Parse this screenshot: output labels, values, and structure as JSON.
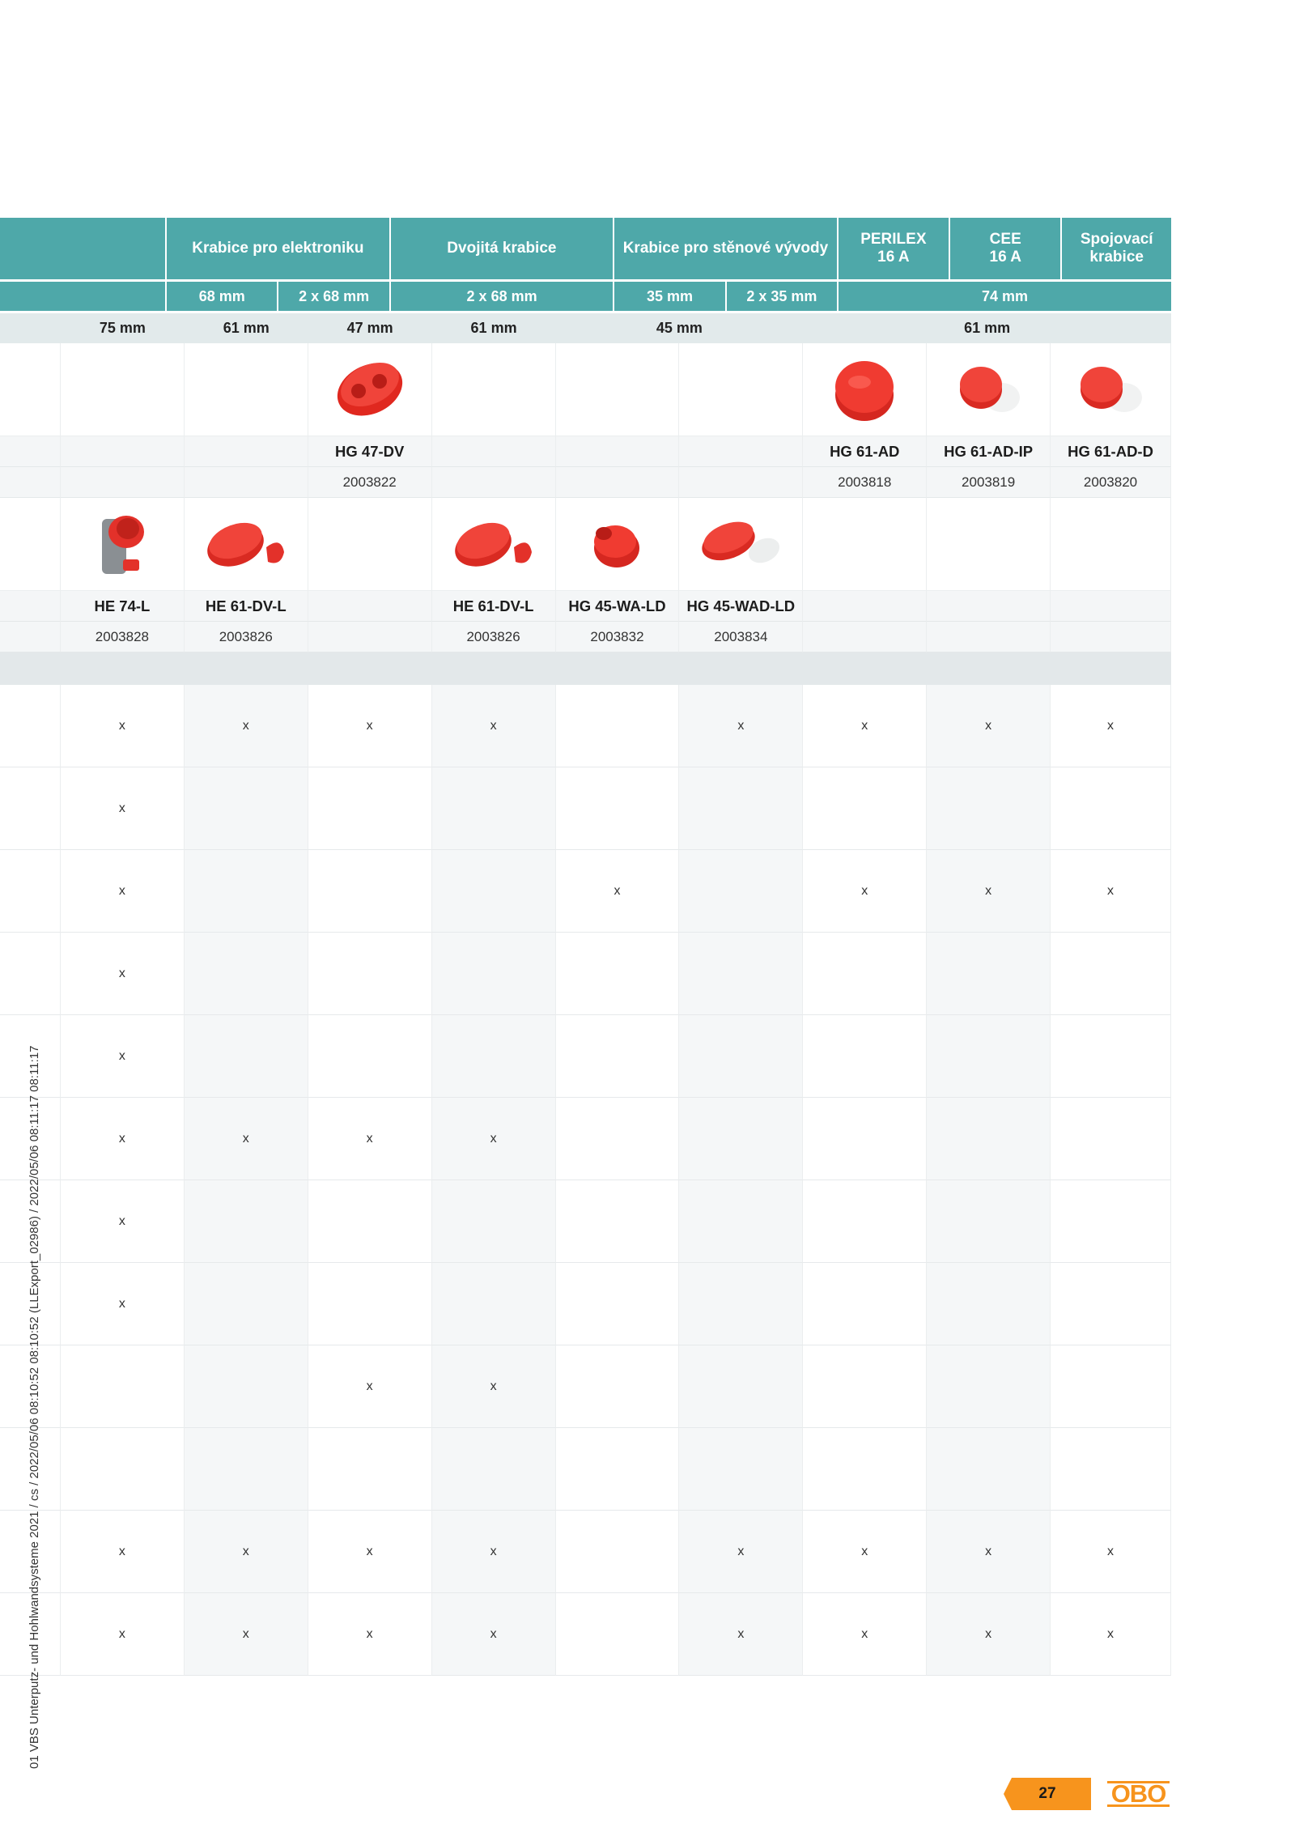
{
  "table": {
    "categories": [
      {
        "label": ""
      },
      {
        "label": "Krabice pro elektroniku"
      },
      {
        "label": "Dvojitá krabice"
      },
      {
        "label": "Krabice pro stěnové vývody"
      },
      {
        "label": "PERILEX\n16 A"
      },
      {
        "label": "CEE\n16 A"
      },
      {
        "label": "Spojovací\nkrabice"
      }
    ],
    "dimensions": [
      "",
      "68 mm",
      "2 x 68 mm",
      "2 x 68 mm",
      "35 mm",
      "2 x 35 mm",
      "74 mm"
    ],
    "depths": [
      "75 mm",
      "61 mm",
      "47 mm",
      "61 mm",
      "45 mm",
      "61 mm"
    ],
    "row_a": {
      "codes": [
        "",
        "",
        "",
        "HG 47-DV",
        "",
        "",
        "",
        "HG 61-AD",
        "HG 61-AD-IP",
        "HG 61-AD-D"
      ],
      "articles": [
        "",
        "",
        "",
        "2003822",
        "",
        "",
        "",
        "2003818",
        "2003819",
        "2003820"
      ]
    },
    "row_b": {
      "codes": [
        "",
        "HE 74-L",
        "HE 61-DV-L",
        "",
        "HE 61-DV-L",
        "HG 45-WA-LD",
        "HG 45-WAD-LD",
        "",
        "",
        ""
      ],
      "articles": [
        "",
        "2003828",
        "2003826",
        "",
        "2003826",
        "2003832",
        "2003834",
        "",
        "",
        ""
      ]
    },
    "marks": [
      [
        "",
        "x",
        "x",
        "x",
        "x",
        "",
        "x",
        "x",
        "x",
        "x"
      ],
      [
        "",
        "x",
        "",
        "",
        "",
        "",
        "",
        "",
        "",
        ""
      ],
      [
        "",
        "x",
        "",
        "",
        "",
        "x",
        "",
        "x",
        "x",
        "x"
      ],
      [
        "",
        "x",
        "",
        "",
        "",
        "",
        "",
        "",
        "",
        ""
      ],
      [
        "",
        "x",
        "",
        "",
        "",
        "",
        "",
        "",
        "",
        ""
      ],
      [
        "",
        "x",
        "x",
        "x",
        "x",
        "",
        "",
        "",
        "",
        ""
      ],
      [
        "",
        "x",
        "",
        "",
        "",
        "",
        "",
        "",
        "",
        ""
      ],
      [
        "",
        "x",
        "",
        "",
        "",
        "",
        "",
        "",
        "",
        ""
      ],
      [
        "",
        "",
        "",
        "x",
        "x",
        "",
        "",
        "",
        "",
        ""
      ],
      [
        "",
        "",
        "",
        "",
        "",
        "",
        "",
        "",
        "",
        ""
      ],
      [
        "",
        "x",
        "x",
        "x",
        "x",
        "",
        "x",
        "x",
        "x",
        "x"
      ],
      [
        "",
        "x",
        "x",
        "x",
        "x",
        "",
        "x",
        "x",
        "x",
        "x"
      ]
    ]
  },
  "footer": {
    "side_text": "01 VBS Unterputz- und Hohlwandsysteme 2021 / cs / 2022/05/06 08:10:52 08:10:52 (LLExport_02986) / 2022/05/06 08:11:17 08:11:17",
    "page_number": "27",
    "logo": "OBO"
  },
  "colors": {
    "header_teal": "#4ea8a9",
    "depth_row": "#e2eaeb",
    "product_red": "#e8302a",
    "brand_orange": "#f7941d"
  }
}
